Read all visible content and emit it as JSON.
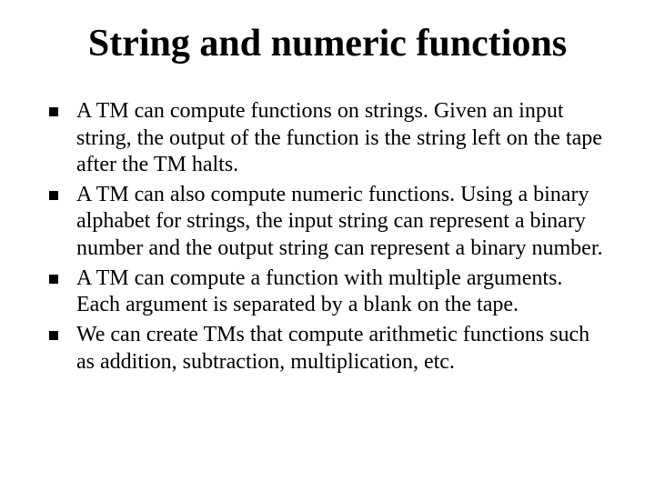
{
  "title": "String and numeric functions",
  "bullets": [
    "A TM can compute functions on strings. Given an input string, the output of the function is the string left on the tape after the TM halts.",
    "A TM can also compute numeric functions. Using a binary alphabet for strings, the input string can represent a binary number and the output string can represent a binary number.",
    "A TM can compute a function with multiple arguments. Each argument is separated by a blank on the tape.",
    "We can create TMs that compute arithmetic functions such as addition, subtraction, multiplication, etc."
  ]
}
